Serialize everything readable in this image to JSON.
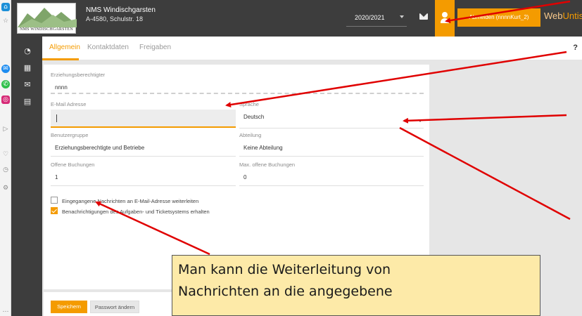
{
  "header": {
    "logo_caption": "NMS WINDISCHGARSTEN",
    "school_name": "NMS Windischgarsten",
    "school_address": "A-4580, Schulstr. 18",
    "school_year": "2020/2021",
    "logout_label": "Abmelden (nnnnKurt_2)",
    "brand_part1": "Web",
    "brand_part2": "Untis"
  },
  "tabs": [
    {
      "label": "Allgemein",
      "active": true
    },
    {
      "label": "Kontaktdaten",
      "active": false
    },
    {
      "label": "Freigaben",
      "active": false
    }
  ],
  "help_label": "?",
  "form": {
    "guardian_label": "Erziehungsberechtigter",
    "guardian_value": "nnnn",
    "email_label": "E-Mail Adresse",
    "email_value": "",
    "language_label": "Sprache",
    "language_value": "Deutsch",
    "usergroup_label": "Benutzergruppe",
    "usergroup_value": "Erziehungsberechtigte und Betriebe",
    "department_label": "Abteilung",
    "department_value": "Keine Abteilung",
    "open_bookings_label": "Offene Buchungen",
    "open_bookings_value": "1",
    "max_open_bookings_label": "Max. offene Buchungen",
    "max_open_bookings_value": "0",
    "checkbox_forward_label": "Eingegangene Nachrichten an E-Mail-Adresse weiterleiten",
    "checkbox_forward_checked": false,
    "checkbox_notify_label": "Benachrichtigungen des Aufgaben- und Ticketsystems erhalten",
    "checkbox_notify_checked": true
  },
  "footer": {
    "save_label": "Speichern",
    "password_label": "Passwort ändern"
  },
  "callout": {
    "line1": "Man kann die Weiterleitung von",
    "line2": "Nachrichten an die angegebene"
  },
  "colors": {
    "accent": "#f49b00",
    "header_bg": "#3d3d3d",
    "arrow": "#e00000",
    "callout_bg": "#fdeaa8"
  },
  "icons": {
    "nav": [
      "dashboard-icon",
      "calendar-icon",
      "messages-icon",
      "book-icon"
    ],
    "header": [
      "mail-icon",
      "user-icon"
    ]
  }
}
